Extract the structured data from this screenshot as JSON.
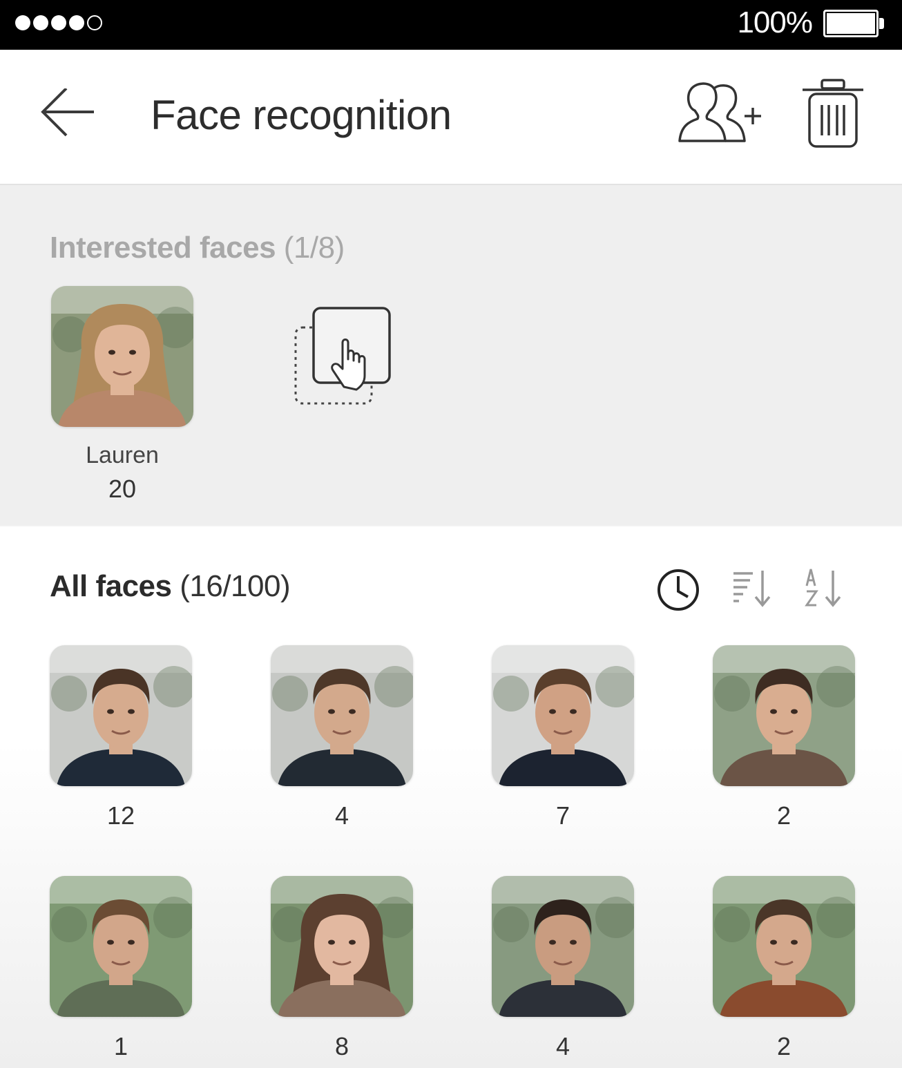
{
  "status_bar": {
    "signal": [
      "full",
      "full",
      "full",
      "full",
      "empty"
    ],
    "battery_text": "100%",
    "battery_level": 1.0
  },
  "header": {
    "title": "Face recognition",
    "back_icon": "arrow-left-icon",
    "add_person_icon": "add-person-icon",
    "trash_icon": "trash-icon"
  },
  "interested": {
    "label": "Interested faces",
    "count": "(1/8)",
    "faces": [
      {
        "name": "Lauren",
        "count": "20",
        "hair": "#b08a5c",
        "skin": "#e0b598",
        "bg": "#8d9a7c",
        "shirt": "#b8876a",
        "long_hair": true
      }
    ],
    "drag_hint_icon": "drag-to-add-icon"
  },
  "all_faces": {
    "label": "All faces",
    "count": "(16/100)",
    "sort_icons": [
      "clock-sort-icon",
      "count-sort-icon",
      "alpha-sort-icon"
    ],
    "faces": [
      {
        "count": "12",
        "hair": "#4a3426",
        "skin": "#d6ab8e",
        "bg": "#c9cbc8",
        "shirt": "#1f2a38",
        "long_hair": false
      },
      {
        "count": "4",
        "hair": "#4e3829",
        "skin": "#d3a98c",
        "bg": "#c6c8c5",
        "shirt": "#222a33",
        "long_hair": false
      },
      {
        "count": "7",
        "hair": "#5a3f2c",
        "skin": "#d0a184",
        "bg": "#d6d7d6",
        "shirt": "#1c2330",
        "long_hair": false
      },
      {
        "count": "2",
        "hair": "#3e2c22",
        "skin": "#d9ad90",
        "bg": "#8fa187",
        "shirt": "#6b5446",
        "long_hair": false
      },
      {
        "count": "1",
        "hair": "#6b4c34",
        "skin": "#d2a68a",
        "bg": "#7f9a74",
        "shirt": "#5f6e56",
        "long_hair": false
      },
      {
        "count": "8",
        "hair": "#5c4030",
        "skin": "#e2b8a0",
        "bg": "#7c9470",
        "shirt": "#8a6f5e",
        "long_hair": true
      },
      {
        "count": "4",
        "hair": "#2e221c",
        "skin": "#c99c80",
        "bg": "#879a80",
        "shirt": "#2c3038",
        "long_hair": false
      },
      {
        "count": "2",
        "hair": "#4a3628",
        "skin": "#d4a88c",
        "bg": "#7e9874",
        "shirt": "#8a4b2e",
        "long_hair": false
      }
    ]
  }
}
